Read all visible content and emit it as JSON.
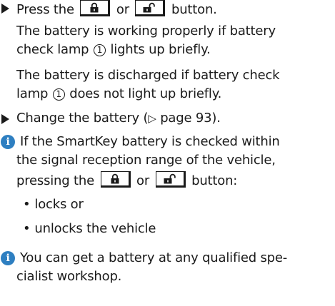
{
  "steps": [
    {
      "pre": "Press the",
      "or": "or",
      "post": "button.",
      "icon_lock": "lock-closed-icon",
      "icon_unlock": "lock-open-icon"
    },
    {
      "pre": "Change the battery (",
      "ref_symbol": "▷",
      "ref_text": " page 93)."
    }
  ],
  "result_ok": {
    "line1": "The battery is working properly if battery",
    "line2_pre": "check lamp",
    "line2_post": "lights up briefly."
  },
  "result_discharged": {
    "line1": "The battery is discharged if battery check",
    "line2_pre": "lamp",
    "line2_post": "does not light up briefly."
  },
  "lamp_number": "1",
  "note1": {
    "line1": "If the SmartKey battery is checked within",
    "line2": "the signal reception range of the vehicle,",
    "line3_pre": "pressing the",
    "line3_or": "or",
    "line3_post": "button:",
    "bullets": [
      "locks or",
      "unlocks the vehicle"
    ]
  },
  "note2": {
    "line1": "You can get a battery at any qualified spe-",
    "line2": "cialist workshop."
  },
  "colors": {
    "info_icon": "#2e7fc1",
    "text": "#1a1a1a"
  }
}
